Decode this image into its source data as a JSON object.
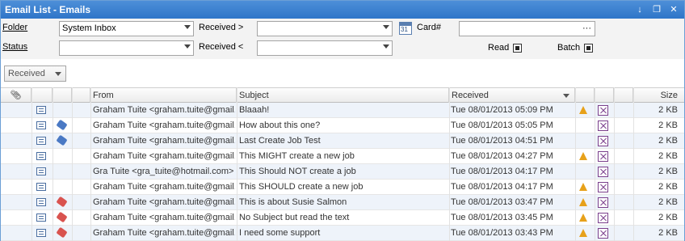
{
  "window": {
    "title": "Email List - Emails",
    "pin_icon": "pin-icon",
    "restore_icon": "restore-icon",
    "close_icon": "close-icon"
  },
  "filters": {
    "folder_label": "Folder",
    "folder_value": "System Inbox",
    "status_label": "Status",
    "status_value": "",
    "received_gt_label": "Received >",
    "received_gt_value": "",
    "received_lt_label": "Received <",
    "received_lt_value": "",
    "card_label": "Card#",
    "card_value": "",
    "card_ellipsis": "···",
    "calendar_num": "31",
    "read_label": "Read",
    "read_checked": true,
    "batch_label": "Batch",
    "batch_checked": true
  },
  "group": {
    "label": "Received"
  },
  "grid": {
    "columns": {
      "attach": "attachment-icon",
      "from": "From",
      "subject": "Subject",
      "received": "Received",
      "size": "Size"
    },
    "rows": [
      {
        "from": "Graham Tuite <graham.tuite@gmail.com>",
        "subject": "Blaaah!",
        "received": "Tue 08/01/2013 05:09 PM",
        "size": "2 KB",
        "tag": "",
        "warn": true
      },
      {
        "from": "Graham Tuite <graham.tuite@gmail.com>",
        "subject": "How about this one?",
        "received": "Tue 08/01/2013 05:05 PM",
        "size": "2 KB",
        "tag": "#4a79c4",
        "warn": false
      },
      {
        "from": "Graham Tuite <graham.tuite@gmail.com>",
        "subject": "Last Create Job Test",
        "received": "Tue 08/01/2013 04:51 PM",
        "size": "2 KB",
        "tag": "#4a79c4",
        "warn": false
      },
      {
        "from": "Graham Tuite <graham.tuite@gmail.com>",
        "subject": "This MIGHT create a new job",
        "received": "Tue 08/01/2013 04:27 PM",
        "size": "2 KB",
        "tag": "",
        "warn": true
      },
      {
        "from": "Gra Tuite <gra_tuite@hotmail.com>",
        "subject": "This Should NOT create a job",
        "received": "Tue 08/01/2013 04:17 PM",
        "size": "2 KB",
        "tag": "",
        "warn": false
      },
      {
        "from": "Graham Tuite <graham.tuite@gmail.com>",
        "subject": "This SHOULD create a new job",
        "received": "Tue 08/01/2013 04:17 PM",
        "size": "2 KB",
        "tag": "",
        "warn": true
      },
      {
        "from": "Graham Tuite <graham.tuite@gmail.com>",
        "subject": "This is about Susie Salmon",
        "received": "Tue 08/01/2013 03:47 PM",
        "size": "2 KB",
        "tag": "#d9534f",
        "warn": true
      },
      {
        "from": "Graham Tuite <graham.tuite@gmail.com>",
        "subject": "No Subject but read the text",
        "received": "Tue 08/01/2013 03:45 PM",
        "size": "2 KB",
        "tag": "#d9534f",
        "warn": true
      },
      {
        "from": "Graham Tuite <graham.tuite@gmail.com>",
        "subject": "I need some support",
        "received": "Tue 08/01/2013 03:43 PM",
        "size": "2 KB",
        "tag": "#d9534f",
        "warn": true
      }
    ]
  }
}
